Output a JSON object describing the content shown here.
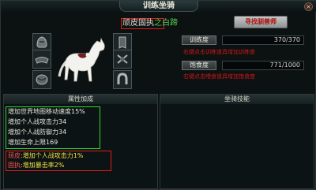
{
  "window": {
    "title": "训练坐骑",
    "close_label": "×"
  },
  "mount": {
    "name_prefix": "顽皮固执",
    "name_suffix": "之白蹄"
  },
  "find_button": {
    "label": "寻找驯兽师"
  },
  "stats": [
    {
      "label": "训练度",
      "value": "370/370",
      "hint": "右键点击训练道具增加训练度"
    },
    {
      "label": "饱食度",
      "value": "771/1000",
      "hint": "右键点击喂食道具增加饱食度"
    }
  ],
  "panels": {
    "attributes": {
      "title": "属性加成"
    },
    "skills": {
      "title": "坐骑技能"
    }
  },
  "bonuses": [
    "增加世界地图移动速度15%",
    "增加个人战攻击力34",
    "增加个人战防御力34",
    "增加生命上限169"
  ],
  "traits": [
    {
      "tag": "顽皮",
      "effect": "增加个人战攻击力1%"
    },
    {
      "tag": "固执",
      "effect": "增加暴击率2%"
    }
  ],
  "equipment_slots": [
    {
      "name": "helm-slot",
      "icon": "helmet-icon"
    },
    {
      "name": "saddle-slot",
      "icon": "saddle-icon"
    },
    {
      "name": "armor-slot",
      "icon": "barding-icon"
    },
    {
      "name": "stirrup-slot",
      "icon": "stirrup-icon"
    },
    {
      "name": "rein-slot",
      "icon": "rein-icon"
    },
    {
      "name": "hoof-slot",
      "icon": "horseshoe-icon"
    }
  ],
  "colors": {
    "highlight_red": "#e01c1c",
    "highlight_green": "#35d235",
    "hint_red": "#d01818",
    "button_text": "#ad0a0a"
  }
}
